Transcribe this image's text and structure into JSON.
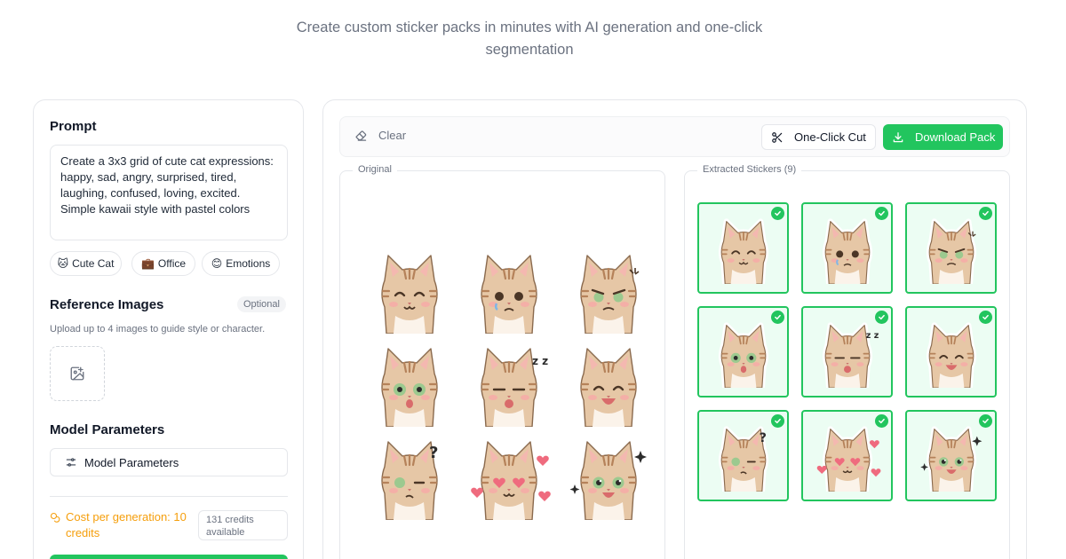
{
  "header": {
    "subtitle": "Create custom sticker packs in minutes with AI generation and one-click segmentation"
  },
  "prompt": {
    "title": "Prompt",
    "text": "Create a 3x3 grid of cute cat expressions: happy, sad, angry, surprised, tired, laughing, confused, loving, excited. Simple kawaii style with pastel colors",
    "presets": [
      {
        "emoji": "🐱",
        "label": "Cute Cat"
      },
      {
        "emoji": "💼",
        "label": "Office"
      },
      {
        "emoji": "😊",
        "label": "Emotions"
      }
    ]
  },
  "reference": {
    "title": "Reference Images",
    "badge": "Optional",
    "hint": "Upload up to 4 images to guide style or character."
  },
  "model": {
    "title": "Model Parameters",
    "button_label": "Model Parameters"
  },
  "cost": {
    "text": "Cost per generation: 10 credits",
    "credits_line1": "131 credits",
    "credits_line2": "available"
  },
  "toolbar": {
    "clear_label": "Clear",
    "cut_label": "One-Click Cut",
    "download_label": "Download Pack"
  },
  "panels": {
    "original_label": "Original",
    "extracted_label": "Extracted Stickers (9)"
  },
  "stickers": [
    "happy",
    "sad",
    "angry",
    "surprised",
    "tired",
    "laughing",
    "confused",
    "loving",
    "excited"
  ],
  "colors": {
    "accent": "#22c55e",
    "warning": "#f59e0b",
    "cat_fur": "#e6c7a6",
    "cat_stripe": "#b5825a",
    "cheek": "#f7a9a8",
    "eye_green": "#9cc98f"
  }
}
